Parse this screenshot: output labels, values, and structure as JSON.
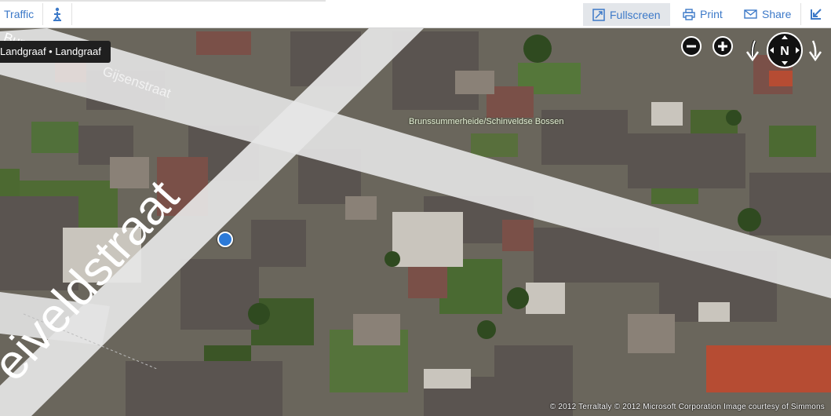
{
  "toolbar": {
    "traffic_label": "Traffic",
    "fullscreen_label": "Fullscreen",
    "print_label": "Print",
    "share_label": "Share"
  },
  "location_pill": "Landgraaf • Landgraaf",
  "labels": {
    "street_top_cut": "Bun",
    "street_gijsen": "Gijsenstraat",
    "street_main": "eiveldstraat",
    "poi": "Brunssummerheide/Schinveldse Bossen"
  },
  "compass": {
    "north_label": "N"
  },
  "copyright": "© 2012 Terraltaly   © 2012 Microsoft Corporation   Image courtesy of Simmons",
  "colors": {
    "accent": "#3c79c8",
    "road": "#e6e6e6",
    "location_dot": "#2c7ad8"
  },
  "icons": {
    "traffic": "traffic-icon",
    "pedestrian": "pedestrian-icon",
    "fullscreen": "fullscreen-icon",
    "print": "print-icon",
    "share": "mail-icon",
    "collapse": "collapse-arrow-icon",
    "zoom_out": "zoom-out-icon",
    "zoom_in": "zoom-in-icon",
    "rotate_left": "rotate-left-icon",
    "rotate_right": "rotate-right-icon",
    "compass": "compass-icon"
  }
}
